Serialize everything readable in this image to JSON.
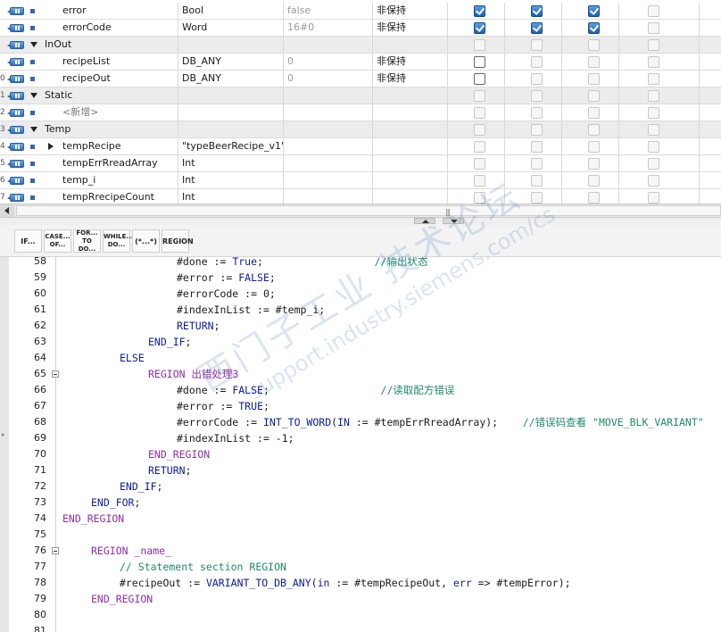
{
  "interface": {
    "rows": [
      {
        "num": "",
        "kind": "var",
        "name": "error",
        "type": "Bool",
        "default": "false",
        "retain": "非保持",
        "checks": [
          "on",
          "on",
          "on",
          "off"
        ]
      },
      {
        "num": "",
        "kind": "var",
        "name": "errorCode",
        "type": "Word",
        "default": "16#0",
        "retain": "非保持",
        "checks": [
          "on",
          "on",
          "on",
          "off"
        ]
      },
      {
        "num": "",
        "kind": "section",
        "name": "InOut",
        "type": "",
        "default": "",
        "retain": "",
        "checks": [
          "off",
          "off",
          "off",
          "off"
        ]
      },
      {
        "num": "",
        "kind": "var",
        "name": "recipeList",
        "type": "DB_ANY",
        "default": "0",
        "retain": "非保持",
        "checks": [
          "en",
          "off",
          "off",
          "off"
        ]
      },
      {
        "num": "0",
        "kind": "var",
        "name": "recipeOut",
        "type": "DB_ANY",
        "default": "0",
        "retain": "非保持",
        "checks": [
          "en",
          "off",
          "off",
          "off"
        ]
      },
      {
        "num": "1",
        "kind": "section",
        "name": "Static",
        "type": "",
        "default": "",
        "retain": "",
        "checks": [
          "off",
          "off",
          "off",
          "off"
        ]
      },
      {
        "num": "2",
        "kind": "placeholder",
        "name": "<新增>",
        "type": "",
        "default": "",
        "retain": "",
        "checks": [
          "off",
          "off",
          "off",
          "off"
        ]
      },
      {
        "num": "3",
        "kind": "section",
        "name": "Temp",
        "type": "",
        "default": "",
        "retain": "",
        "checks": [
          "off",
          "off",
          "off",
          "off"
        ]
      },
      {
        "num": "4",
        "kind": "struct",
        "name": "tempRecipe",
        "type": "\"typeBeerRecipe_v1\"",
        "default": "",
        "retain": "",
        "checks": [
          "off",
          "off",
          "off",
          "off"
        ]
      },
      {
        "num": "5",
        "kind": "var",
        "name": "tempErrRreadArray",
        "type": "Int",
        "default": "",
        "retain": "",
        "checks": [
          "off",
          "off",
          "off",
          "off"
        ]
      },
      {
        "num": "6",
        "kind": "var",
        "name": "temp_i",
        "type": "Int",
        "default": "",
        "retain": "",
        "checks": [
          "off",
          "off",
          "off",
          "off"
        ]
      },
      {
        "num": "7",
        "kind": "var",
        "name": "tempRrecipeCount",
        "type": "Int",
        "default": "",
        "retain": "",
        "checks": [
          "off",
          "off",
          "off",
          "off"
        ]
      }
    ]
  },
  "scrollbar": {
    "grip": "|||"
  },
  "toolbar": {
    "buttons": [
      {
        "id": "if",
        "line1": "IF...",
        "line2": ""
      },
      {
        "id": "case",
        "line1": "CASE...",
        "line2": "OF..."
      },
      {
        "id": "for",
        "line1": "FOR...",
        "line2": "TO DO..."
      },
      {
        "id": "while",
        "line1": "WHILE...",
        "line2": "DO..."
      },
      {
        "id": "comment",
        "line1": "(*...*)",
        "line2": ""
      },
      {
        "id": "region",
        "line1": "REGION",
        "line2": ""
      }
    ]
  },
  "editor": {
    "lines": [
      {
        "n": "58",
        "fold": false,
        "indent": 16,
        "tokens": [
          [
            "var",
            "#done"
          ],
          [
            "op",
            " := "
          ],
          [
            "kw",
            "True"
          ],
          [
            "op",
            ";"
          ],
          [
            "op",
            "                  "
          ],
          [
            "cmt",
            "//输出状态"
          ]
        ]
      },
      {
        "n": "59",
        "fold": false,
        "indent": 16,
        "tokens": [
          [
            "var",
            "#error"
          ],
          [
            "op",
            " := "
          ],
          [
            "kw",
            "FALSE"
          ],
          [
            "op",
            ";"
          ]
        ]
      },
      {
        "n": "60",
        "fold": false,
        "indent": 16,
        "tokens": [
          [
            "var",
            "#errorCode"
          ],
          [
            "op",
            " := "
          ],
          [
            "lit",
            "0"
          ],
          [
            "op",
            ";"
          ]
        ]
      },
      {
        "n": "61",
        "fold": false,
        "indent": 16,
        "tokens": [
          [
            "var",
            "#indexInList"
          ],
          [
            "op",
            " := "
          ],
          [
            "var",
            "#temp_i"
          ],
          [
            "op",
            ";"
          ]
        ]
      },
      {
        "n": "62",
        "fold": false,
        "indent": 16,
        "tokens": [
          [
            "kw",
            "RETURN"
          ],
          [
            "op",
            ";"
          ]
        ]
      },
      {
        "n": "63",
        "fold": false,
        "indent": 12,
        "tokens": [
          [
            "kw",
            "END_IF"
          ],
          [
            "op",
            ";"
          ]
        ]
      },
      {
        "n": "64",
        "fold": false,
        "indent": 8,
        "tokens": [
          [
            "kw",
            "ELSE"
          ]
        ]
      },
      {
        "n": "65",
        "fold": true,
        "indent": 12,
        "tokens": [
          [
            "reg",
            "REGION 出错处理3"
          ]
        ]
      },
      {
        "n": "66",
        "fold": false,
        "indent": 16,
        "tokens": [
          [
            "var",
            "#done"
          ],
          [
            "op",
            " := "
          ],
          [
            "kw",
            "FALSE"
          ],
          [
            "op",
            ";"
          ],
          [
            "op",
            "                  "
          ],
          [
            "cmt",
            "//读取配方错误"
          ]
        ]
      },
      {
        "n": "67",
        "fold": false,
        "indent": 16,
        "tokens": [
          [
            "var",
            "#error"
          ],
          [
            "op",
            " := "
          ],
          [
            "kw",
            "TRUE"
          ],
          [
            "op",
            ";"
          ]
        ]
      },
      {
        "n": "68",
        "fold": false,
        "indent": 16,
        "tokens": [
          [
            "var",
            "#errorCode"
          ],
          [
            "op",
            " := "
          ],
          [
            "kw",
            "INT_TO_WORD"
          ],
          [
            "op",
            "("
          ],
          [
            "kw",
            "IN"
          ],
          [
            "op",
            " := "
          ],
          [
            "var",
            "#tempErrRreadArray"
          ],
          [
            "op",
            ");"
          ],
          [
            "op",
            "    "
          ],
          [
            "cmt",
            "//错误码查看 \"MOVE_BLK_VARIANT\""
          ]
        ]
      },
      {
        "n": "69",
        "fold": false,
        "indent": 16,
        "tokens": [
          [
            "var",
            "#indexInList"
          ],
          [
            "op",
            " := "
          ],
          [
            "lit",
            "-1"
          ],
          [
            "op",
            ";"
          ]
        ]
      },
      {
        "n": "70",
        "fold": false,
        "indent": 12,
        "tokens": [
          [
            "reg",
            "END_REGION"
          ]
        ]
      },
      {
        "n": "71",
        "fold": false,
        "indent": 12,
        "tokens": [
          [
            "kw",
            "RETURN"
          ],
          [
            "op",
            ";"
          ]
        ]
      },
      {
        "n": "72",
        "fold": false,
        "indent": 8,
        "tokens": [
          [
            "kw",
            "END_IF"
          ],
          [
            "op",
            ";"
          ]
        ]
      },
      {
        "n": "73",
        "fold": false,
        "indent": 4,
        "tokens": [
          [
            "kw",
            "END_FOR"
          ],
          [
            "op",
            ";"
          ]
        ]
      },
      {
        "n": "74",
        "fold": false,
        "indent": 0,
        "tokens": [
          [
            "reg",
            "END_REGION"
          ]
        ]
      },
      {
        "n": "75",
        "fold": false,
        "indent": 0,
        "tokens": []
      },
      {
        "n": "76",
        "fold": true,
        "indent": 4,
        "tokens": [
          [
            "reg",
            "REGION _name_"
          ]
        ]
      },
      {
        "n": "77",
        "fold": false,
        "indent": 8,
        "tokens": [
          [
            "cmt",
            "// Statement section REGION"
          ]
        ]
      },
      {
        "n": "78",
        "fold": false,
        "indent": 8,
        "tokens": [
          [
            "var",
            "#recipeOut"
          ],
          [
            "op",
            " := "
          ],
          [
            "kw",
            "VARIANT_TO_DB_ANY"
          ],
          [
            "op",
            "("
          ],
          [
            "kw",
            "in"
          ],
          [
            "op",
            " := "
          ],
          [
            "var",
            "#tempRecipeOut"
          ],
          [
            "op",
            ", "
          ],
          [
            "kw",
            "err"
          ],
          [
            "op",
            " => "
          ],
          [
            "var",
            "#tempError"
          ],
          [
            "op",
            ");"
          ]
        ]
      },
      {
        "n": "79",
        "fold": false,
        "indent": 4,
        "tokens": [
          [
            "reg",
            "END_REGION"
          ]
        ]
      },
      {
        "n": "80",
        "fold": false,
        "indent": 0,
        "tokens": []
      },
      {
        "n": "81",
        "fold": false,
        "indent": 0,
        "tokens": []
      }
    ]
  },
  "watermark": {
    "cn": "西门子工业 技术论坛",
    "url": "support.industry.siemens.com/cs"
  },
  "colors": {
    "keyword": "#0b1a9c",
    "region": "#8f2ea8",
    "comment": "#1f8a70",
    "checkbox_on": "#1d5fb0"
  }
}
